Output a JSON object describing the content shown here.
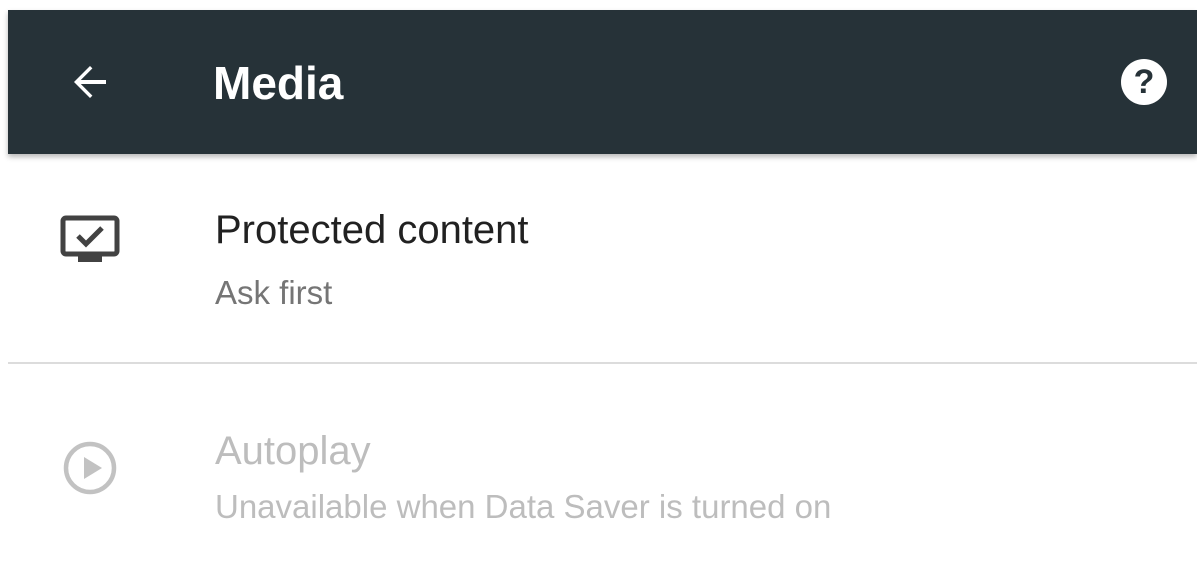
{
  "app_bar": {
    "title": "Media",
    "back_icon": "arrow-back-icon",
    "help_icon": "help-circle-icon",
    "help_glyph": "?",
    "background_color": "#263238"
  },
  "settings": [
    {
      "title": "Protected content",
      "summary": "Ask first",
      "icon": "protected-content-icon",
      "enabled": true
    },
    {
      "title": "Autoplay",
      "summary": "Unavailable when Data Saver is turned on",
      "icon": "play-circle-icon",
      "enabled": false
    }
  ],
  "colors": {
    "primary_text": "#212121",
    "secondary_text": "#757575",
    "disabled_text": "#bdbdbd",
    "icon_enabled": "#424242",
    "icon_disabled": "#c2c2c2"
  }
}
